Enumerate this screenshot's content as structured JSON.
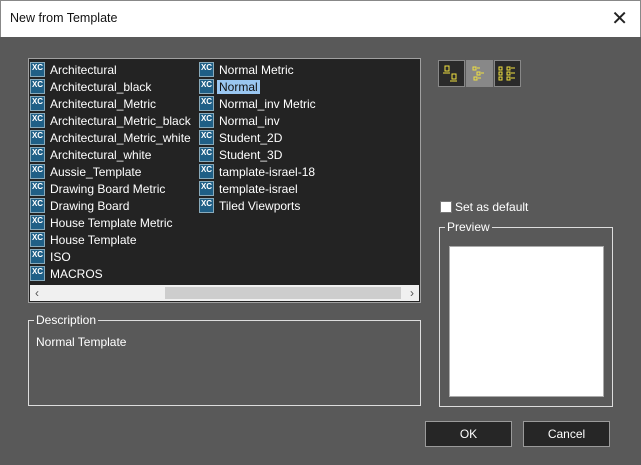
{
  "window": {
    "title": "New from Template"
  },
  "templates": {
    "col1": [
      "Architectural",
      "Architectural_black",
      "Architectural_Metric",
      "Architectural_Metric_black",
      "Architectural_Metric_white",
      "Architectural_white",
      "Aussie_Template",
      "Drawing Board Metric",
      "Drawing Board",
      "House Template Metric",
      "House Template",
      "ISO",
      "MACROS"
    ],
    "col2": [
      "Normal Metric",
      "Normal",
      "Normal_inv Metric",
      "Normal_inv",
      "Student_2D",
      "Student_3D",
      "tamplate-israel-18",
      "template-israel",
      "Tiled Viewports"
    ],
    "selected": "Normal",
    "icon": "xc-file-icon"
  },
  "view_modes": {
    "buttons": [
      "large-icons",
      "list",
      "details"
    ],
    "active": "list",
    "icon_color": "#f0e040"
  },
  "set_default": {
    "label": "Set as default",
    "checked": false
  },
  "description": {
    "label": "Description",
    "text": "Normal Template"
  },
  "preview": {
    "label": "Preview"
  },
  "buttons": {
    "ok": "OK",
    "cancel": "Cancel"
  },
  "colors": {
    "background": "#595959",
    "list_bg": "#232323",
    "selection": "#99c6f0"
  }
}
